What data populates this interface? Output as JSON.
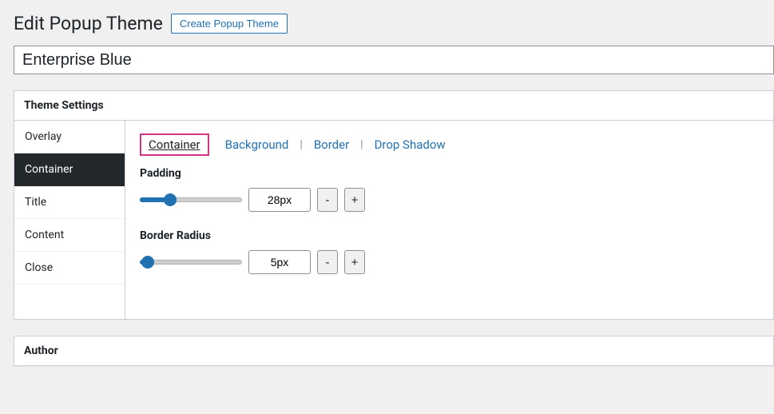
{
  "header": {
    "title": "Edit Popup Theme",
    "create_button": "Create Popup Theme"
  },
  "title_field": {
    "value": "Enterprise Blue"
  },
  "panel": {
    "title": "Theme Settings",
    "vtabs": [
      {
        "label": "Overlay",
        "active": false
      },
      {
        "label": "Container",
        "active": true
      },
      {
        "label": "Title",
        "active": false
      },
      {
        "label": "Content",
        "active": false
      },
      {
        "label": "Close",
        "active": false
      }
    ],
    "subtabs": [
      {
        "label": "Container",
        "active": true
      },
      {
        "label": "Background",
        "active": false
      },
      {
        "label": "Border",
        "active": false
      },
      {
        "label": "Drop Shadow",
        "active": false
      }
    ],
    "fields": {
      "padding": {
        "label": "Padding",
        "value": "28px",
        "slider_percent": 30,
        "minus": "-",
        "plus": "+"
      },
      "border_radius": {
        "label": "Border Radius",
        "value": "5px",
        "slider_percent": 8,
        "minus": "-",
        "plus": "+"
      }
    }
  },
  "author_panel": {
    "title": "Author"
  }
}
